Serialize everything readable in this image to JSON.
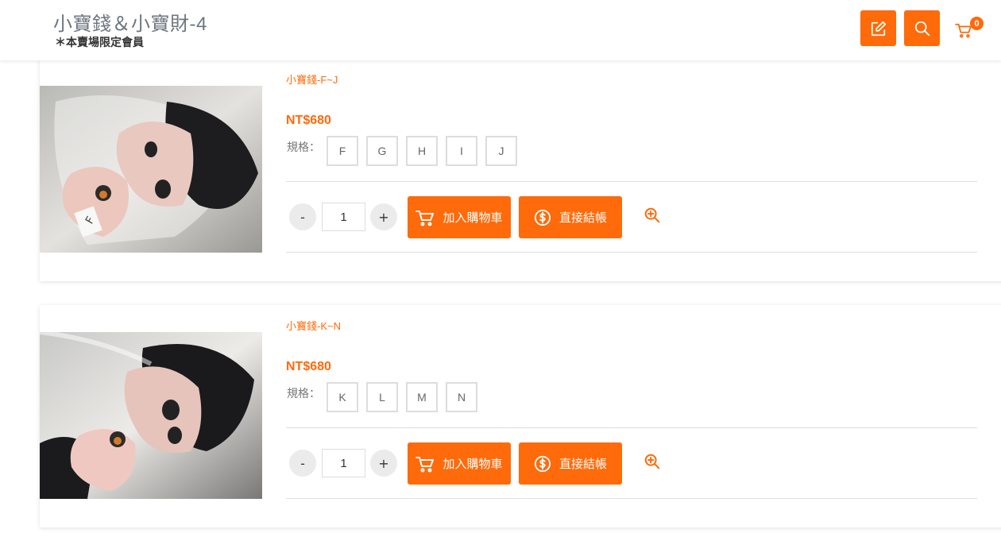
{
  "header": {
    "title": "小寶錢＆小寶財-4",
    "subtitle": "＊本賣場限定會員",
    "edit_icon": "edit-icon",
    "search_icon": "search-icon",
    "cart_count": "0"
  },
  "colors": {
    "accent": "#ff6a0a"
  },
  "products": [
    {
      "name": "小寶錢-F~J",
      "price": "NT$680",
      "spec_label": "規格：",
      "options": [
        "F",
        "G",
        "H",
        "I",
        "J"
      ],
      "quantity": "1",
      "minus": "-",
      "plus": "+",
      "add_to_cart": "加入購物車",
      "checkout": "直接結帳"
    },
    {
      "name": "小寶錢-K~N",
      "price": "NT$680",
      "spec_label": "規格：",
      "options": [
        "K",
        "L",
        "M",
        "N"
      ],
      "quantity": "1",
      "minus": "-",
      "plus": "+",
      "add_to_cart": "加入購物車",
      "checkout": "直接結帳"
    }
  ]
}
